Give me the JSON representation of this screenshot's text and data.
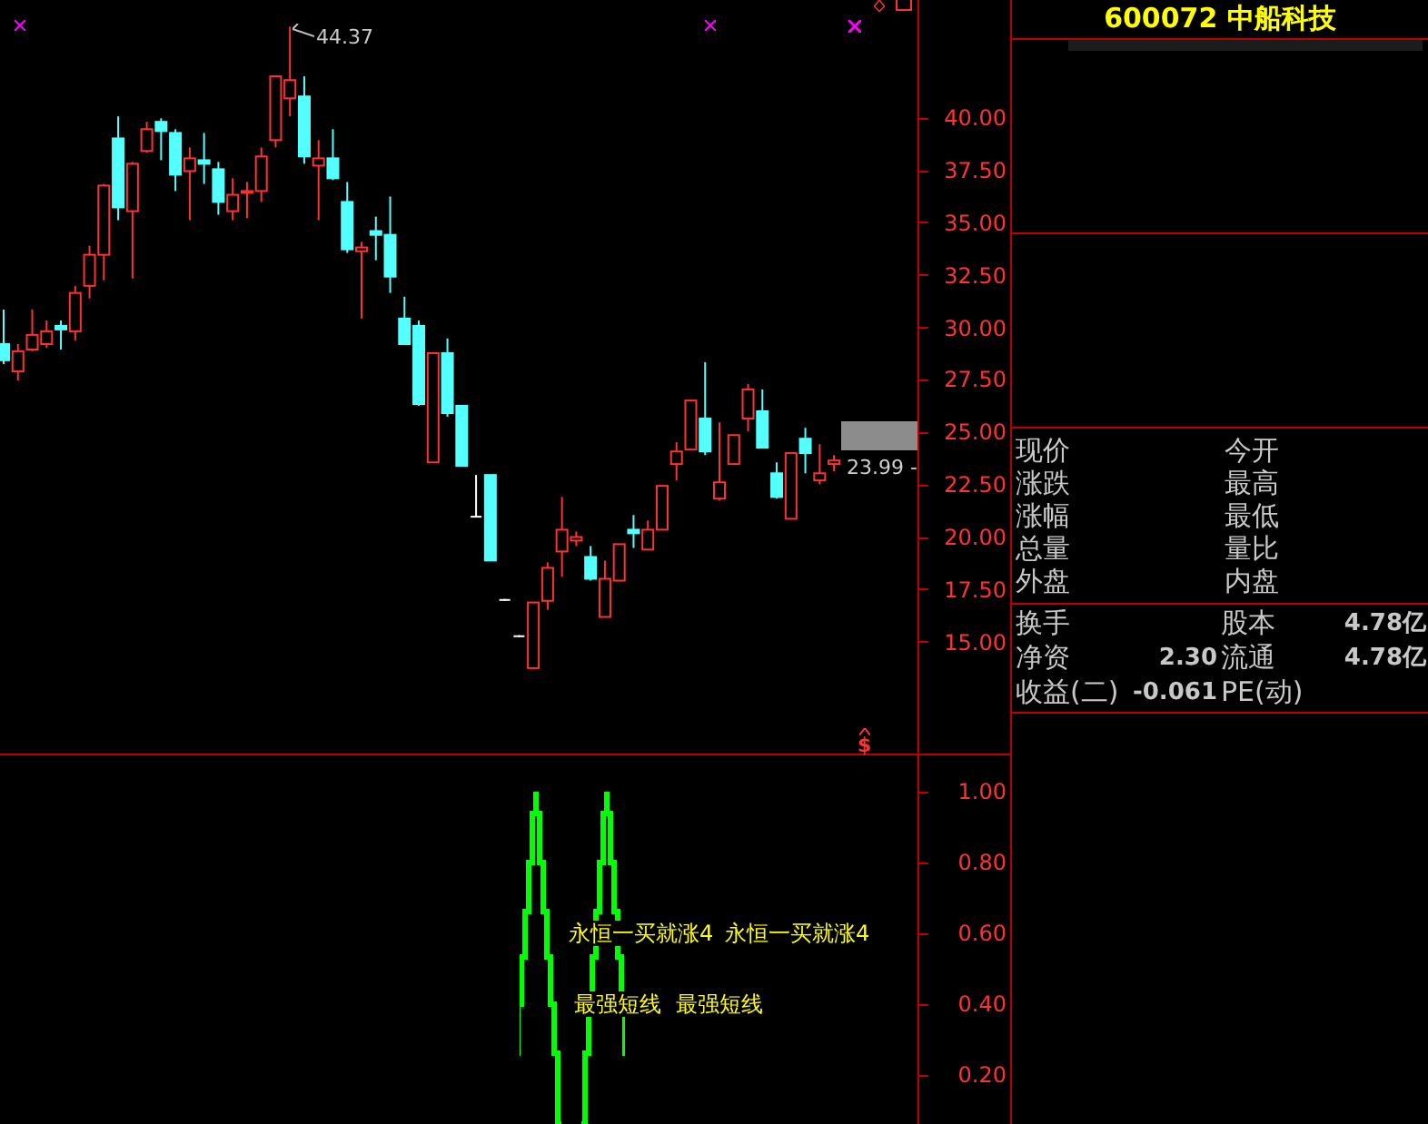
{
  "price_chart": {
    "high_label": "44.37",
    "last_label": "23.99 -",
    "signal_mark": "$",
    "chart_data": {
      "type": "candlestick",
      "ohlc": [
        [
          29.23,
          30.88,
          28.28,
          28.46
        ],
        [
          27.93,
          29.23,
          27.5,
          28.89
        ],
        [
          28.97,
          30.88,
          28.89,
          29.67
        ],
        [
          29.23,
          30.36,
          29.06,
          29.84
        ],
        [
          30.1,
          30.36,
          28.97,
          29.93
        ],
        [
          29.84,
          32.01,
          29.41,
          31.67
        ],
        [
          32.01,
          33.92,
          31.41,
          33.49
        ],
        [
          33.49,
          36.87,
          32.27,
          36.79
        ],
        [
          39.04,
          40.09,
          35.14,
          35.75
        ],
        [
          35.57,
          37.92,
          32.36,
          37.83
        ],
        [
          38.44,
          39.83,
          38.35,
          39.48
        ],
        [
          39.83,
          40.0,
          38.0,
          39.39
        ],
        [
          39.3,
          39.48,
          36.53,
          37.31
        ],
        [
          37.48,
          38.61,
          35.14,
          38.09
        ],
        [
          38.0,
          39.3,
          36.87,
          37.83
        ],
        [
          37.57,
          37.92,
          35.4,
          36.01
        ],
        [
          35.57,
          37.14,
          35.14,
          36.35
        ],
        [
          36.44,
          36.96,
          35.23,
          36.53
        ],
        [
          36.53,
          38.61,
          36.01,
          38.18
        ],
        [
          38.96,
          42.0,
          38.61,
          42.0
        ],
        [
          40.95,
          44.37,
          40.09,
          41.82
        ],
        [
          41.04,
          42.0,
          37.83,
          38.18
        ],
        [
          37.74,
          38.96,
          35.14,
          38.09
        ],
        [
          38.09,
          39.48,
          37.05,
          37.14
        ],
        [
          36.01,
          36.96,
          33.58,
          33.75
        ],
        [
          33.66,
          34.1,
          30.45,
          33.84
        ],
        [
          34.62,
          35.31,
          33.23,
          34.44
        ],
        [
          34.44,
          36.27,
          31.67,
          32.45
        ],
        [
          30.45,
          31.49,
          29.23,
          29.23
        ],
        [
          30.1,
          30.36,
          26.29,
          26.37
        ],
        [
          23.59,
          28.8,
          23.59,
          28.8
        ],
        [
          28.8,
          29.5,
          25.77,
          25.94
        ],
        [
          26.29,
          26.29,
          23.42,
          23.42
        ],
        [
          21.0,
          22.99,
          20.99,
          21.0
        ],
        [
          22.99,
          22.99,
          18.91,
          18.91
        ],
        [
          17.03,
          17.08,
          16.99,
          17.03
        ],
        [
          15.3,
          15.35,
          15.26,
          15.3
        ],
        [
          13.78,
          16.91,
          13.78,
          16.91
        ],
        [
          16.99,
          18.82,
          16.56,
          18.56
        ],
        [
          19.34,
          21.94,
          18.13,
          20.38
        ],
        [
          19.86,
          20.29,
          19.6,
          20.03
        ],
        [
          19.08,
          19.6,
          17.95,
          18.04
        ],
        [
          16.22,
          18.91,
          16.22,
          18.04
        ],
        [
          17.95,
          19.69,
          17.95,
          19.69
        ],
        [
          20.38,
          21.08,
          19.51,
          20.21
        ],
        [
          19.43,
          20.82,
          19.43,
          20.38
        ],
        [
          20.38,
          22.47,
          20.38,
          22.47
        ],
        [
          23.51,
          24.55,
          22.73,
          24.11
        ],
        [
          24.2,
          26.54,
          24.2,
          26.54
        ],
        [
          25.68,
          28.37,
          23.94,
          24.11
        ],
        [
          21.86,
          25.5,
          21.77,
          22.64
        ],
        [
          23.51,
          24.89,
          23.51,
          24.89
        ],
        [
          25.68,
          27.33,
          25.07,
          27.07
        ],
        [
          26.03,
          27.07,
          24.29,
          24.29
        ],
        [
          23.07,
          23.59,
          21.86,
          21.94
        ],
        [
          20.9,
          24.03,
          20.9,
          24.03
        ],
        [
          24.72,
          25.24,
          23.07,
          24.03
        ],
        [
          22.73,
          24.46,
          22.55,
          23.07
        ],
        [
          23.51,
          23.94,
          23.16,
          23.68
        ]
      ],
      "ylim": [
        -7.96,
        45.64
      ],
      "yticks": [
        {
          "value": 40,
          "label": "40.00"
        },
        {
          "value": 37.5,
          "label": "37.50"
        },
        {
          "value": 35,
          "label": "35.00"
        },
        {
          "value": 32.5,
          "label": "32.50"
        },
        {
          "value": 30,
          "label": "30.00"
        },
        {
          "value": 27.5,
          "label": "27.50"
        },
        {
          "value": 25,
          "label": "25.00"
        },
        {
          "value": 22.5,
          "label": "22.50"
        },
        {
          "value": 20,
          "label": "20.00"
        },
        {
          "value": 17.5,
          "label": "17.50"
        },
        {
          "value": 15,
          "label": "15.00"
        }
      ]
    }
  },
  "indicator": {
    "axis": [
      "1.00",
      "0.80",
      "0.60",
      "0.40",
      "0.20"
    ],
    "signal_lines": [
      [
        "永恒一买就涨4",
        "永恒一买就涨4"
      ],
      [
        "最强短线",
        "最强短线"
      ]
    ]
  },
  "quote_panel": {
    "title": "600072 中船科技",
    "rows": [
      {
        "left": "现价",
        "right": "今开"
      },
      {
        "left": "涨跌",
        "right": "最高"
      },
      {
        "left": "涨幅",
        "right": "最低"
      },
      {
        "left": "总量",
        "right": "量比"
      },
      {
        "left": "外盘",
        "right": "内盘"
      }
    ],
    "stats": [
      {
        "left_label": "换手",
        "right_label": "股本",
        "right_value": "4.78亿"
      },
      {
        "left_label": "净资",
        "left_value": "2.30",
        "right_label": "流通",
        "right_value": "4.78亿"
      },
      {
        "left_label": "收益(二)",
        "left_value": "-0.061",
        "right_label": "PE(动)"
      }
    ]
  }
}
